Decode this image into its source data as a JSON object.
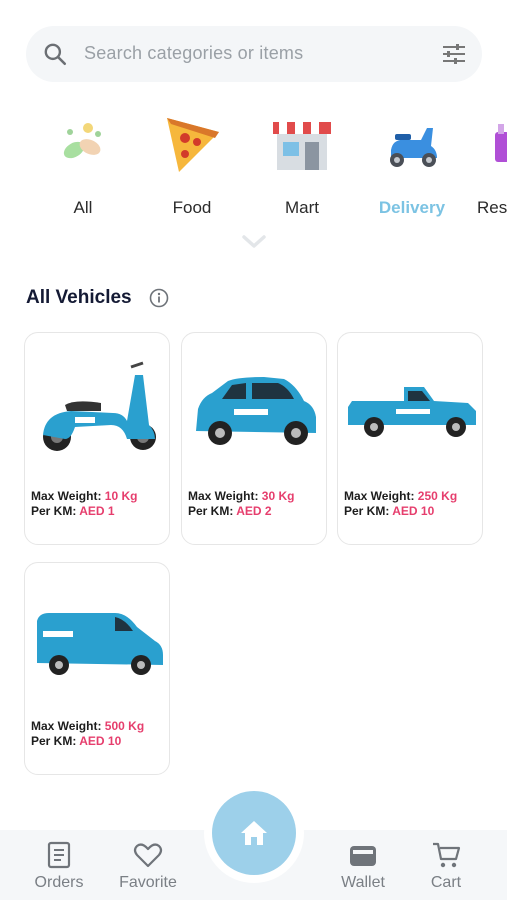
{
  "search": {
    "placeholder": "Search categories or items"
  },
  "categories": [
    {
      "label": "All",
      "icon": "all-categories-icon"
    },
    {
      "label": "Food",
      "icon": "pizza-icon"
    },
    {
      "label": "Mart",
      "icon": "store-icon"
    },
    {
      "label": "Delivery",
      "icon": "scooter-icon",
      "active": true
    },
    {
      "label": "Res",
      "icon": "restaurant-icon"
    }
  ],
  "section": {
    "title": "All Vehicles"
  },
  "vehicles": [
    {
      "type": "scooter",
      "weight_label": "Max Weight:",
      "weight": "10 Kg",
      "price_label": "Per KM:",
      "price": "AED 1"
    },
    {
      "type": "car",
      "weight_label": "Max Weight:",
      "weight": "30 Kg",
      "price_label": "Per KM:",
      "price": "AED 2"
    },
    {
      "type": "pickup-truck",
      "weight_label": "Max Weight:",
      "weight": "250 Kg",
      "price_label": "Per KM:",
      "price": "AED 10"
    },
    {
      "type": "van",
      "weight_label": "Max Weight:",
      "weight": "500 Kg",
      "price_label": "Per KM:",
      "price": "AED 10"
    }
  ],
  "nav": {
    "orders": "Orders",
    "favorite": "Favorite",
    "wallet": "Wallet",
    "cart": "Cart"
  },
  "colors": {
    "accent": "#7cc3e3",
    "price": "#e63e6d",
    "vehicle": "#2fa3cf",
    "home": "#9dd0ea"
  }
}
